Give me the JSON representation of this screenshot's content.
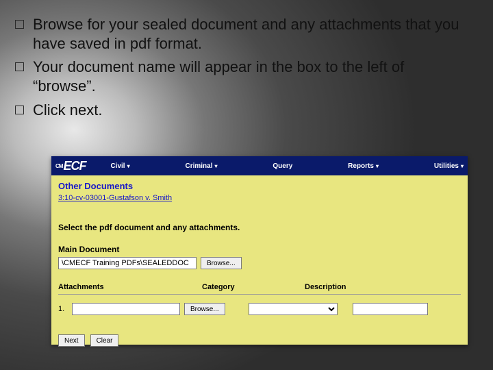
{
  "bullets": [
    "Browse for your sealed document and any attachments that you have saved in pdf format.",
    "Your document name will appear in the box to the left of “browse”.",
    "Click next."
  ],
  "ecf": {
    "logo_cm": "CM",
    "logo_ecf": "ECF",
    "menu": {
      "civil": "Civil",
      "criminal": "Criminal",
      "query": "Query",
      "reports": "Reports",
      "utilities": "Utilities"
    },
    "section_title": "Other Documents",
    "case_link": "3:10-cv-03001-Gustafson v. Smith",
    "instruction": "Select the pdf document and any attachments.",
    "main_doc_label": "Main Document",
    "main_doc_value": "\\CMECF Training PDFs\\SEALEDDOC",
    "browse_label": "Browse...",
    "attach_headers": {
      "attachments": "Attachments",
      "category": "Category",
      "description": "Description"
    },
    "attach_rows": [
      {
        "num": "1.",
        "file": "",
        "category": "",
        "description": ""
      }
    ],
    "buttons": {
      "next": "Next",
      "clear": "Clear"
    }
  }
}
